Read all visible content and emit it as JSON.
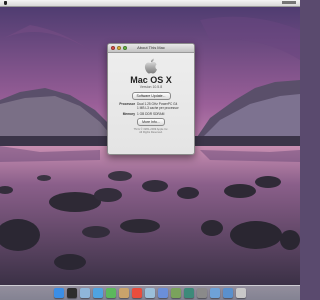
{
  "window": {
    "title": "About This Mac",
    "product_name": "Mac OS X",
    "version": "Version 10.5.8",
    "software_update_label": "Software Update...",
    "processor_label": "Processor",
    "processor_value": "Dual 1.25 GHz PowerPC G4",
    "processor_note": "1 MB L3 cache per processor",
    "memory_label": "Memory",
    "memory_value": "1 GB DDR SDRAM",
    "more_info_label": "More Info...",
    "legal_line1": "TM & © 1983–2009 Apple Inc.",
    "legal_line2": "All Rights Reserved."
  },
  "desktop": {
    "wallpaper": "Yosemite lake at dusk",
    "sky_top": "#5f3f7a",
    "sky_mid": "#b76f9e",
    "sky_glow": "#e9c3d6",
    "water": "#4a3d5c"
  },
  "dock": {
    "icons": [
      {
        "name": "finder-icon",
        "color": "#3b8ee6"
      },
      {
        "name": "dashboard-icon",
        "color": "#2d2d2d"
      },
      {
        "name": "mail-icon",
        "color": "#8fb6d9"
      },
      {
        "name": "safari-icon",
        "color": "#4fa3e0"
      },
      {
        "name": "ichat-icon",
        "color": "#5cb85c"
      },
      {
        "name": "address-book-icon",
        "color": "#c9a36b"
      },
      {
        "name": "ical-icon",
        "color": "#e84d3d"
      },
      {
        "name": "preview-icon",
        "color": "#9bbfd9"
      },
      {
        "name": "itunes-icon",
        "color": "#6b8fd9"
      },
      {
        "name": "iphoto-icon",
        "color": "#7aa35c"
      },
      {
        "name": "time-machine-icon",
        "color": "#3d8a7a"
      },
      {
        "name": "system-preferences-icon",
        "color": "#8a8a8a"
      },
      {
        "name": "documents-stack-icon",
        "color": "#6ea2d8"
      },
      {
        "name": "downloads-stack-icon",
        "color": "#5a90cc"
      },
      {
        "name": "trash-icon",
        "color": "#c8c8c8"
      }
    ]
  }
}
